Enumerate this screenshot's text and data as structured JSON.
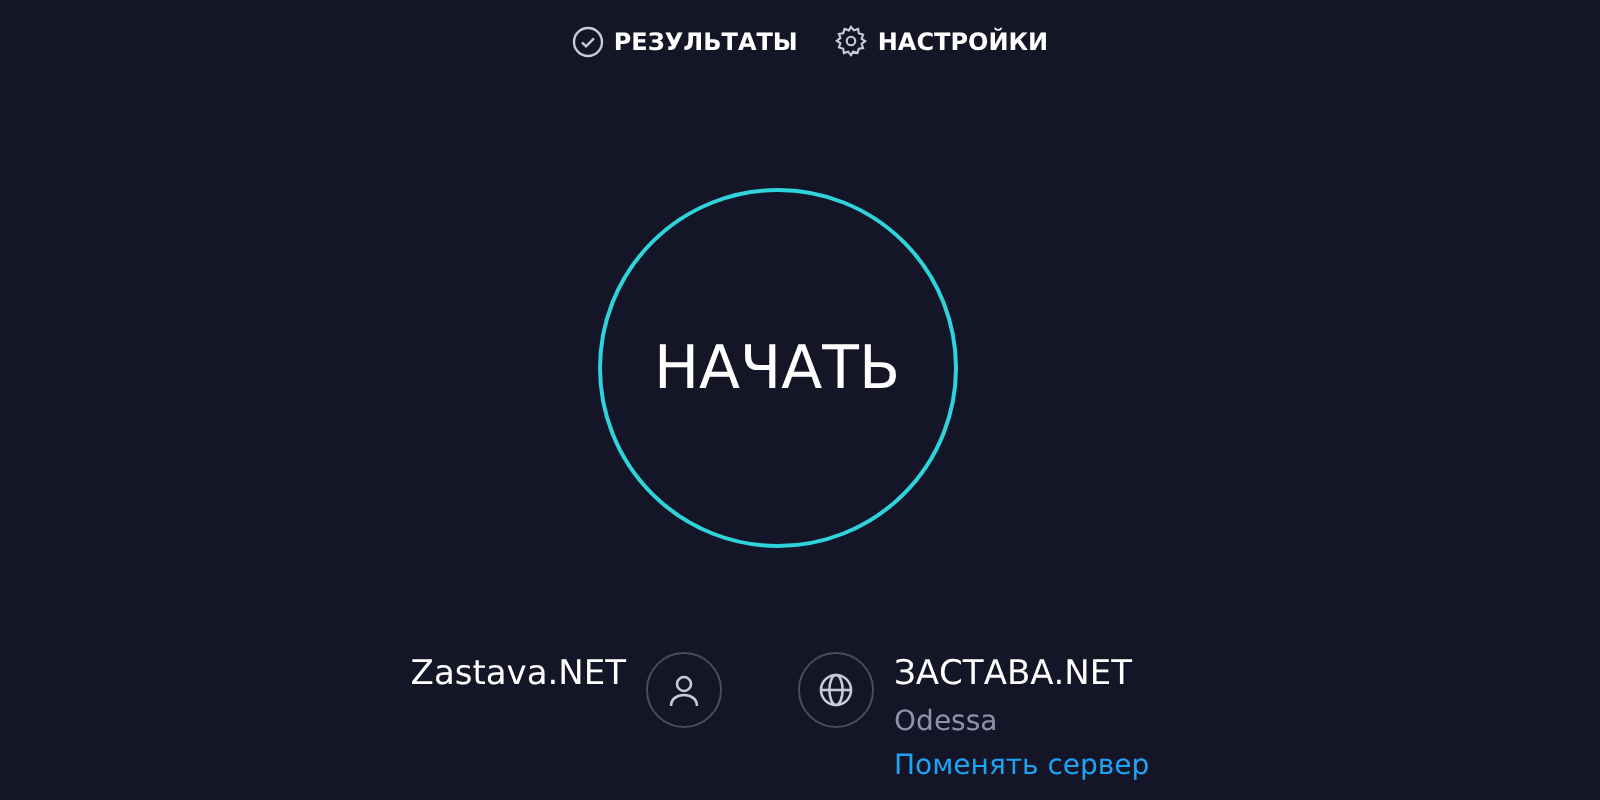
{
  "nav": [
    {
      "kind": "results",
      "label": "РЕЗУЛЬТАТЫ"
    },
    {
      "kind": "settings",
      "label": "НАСТРОЙКИ"
    }
  ],
  "start_button": {
    "label": "НАЧАТЬ"
  },
  "provider": {
    "name": "Zastava.NET"
  },
  "server": {
    "name": "ЗАСТАВА.NET",
    "location": "Odessa",
    "change_link": "Поменять сервер"
  }
}
